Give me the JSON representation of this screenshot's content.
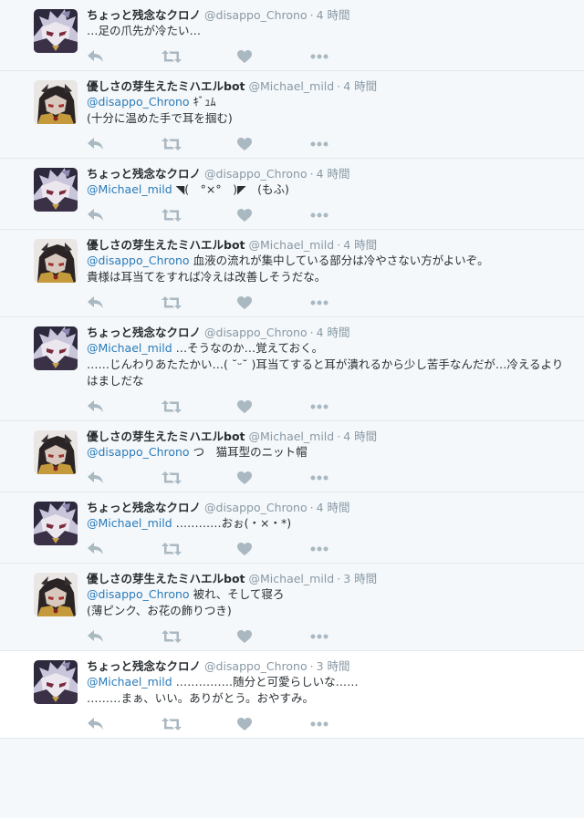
{
  "tweets": [
    {
      "user": "chrono",
      "name": "ちょっと残念なクロノ",
      "handle": "@disappo_Chrono",
      "time": "4 時間",
      "mention": "",
      "body": "…足の爪先が冷たい…",
      "alt": false
    },
    {
      "user": "michael",
      "name": "優しさの芽生えたミハエルbot",
      "handle": "@Michael_mild",
      "time": "4 時間",
      "mention": "@disappo_Chrono",
      "body": " ｷﾞｭﾑ\n(十分に温めた手で耳を掴む)",
      "alt": false
    },
    {
      "user": "chrono",
      "name": "ちょっと残念なクロノ",
      "handle": "@disappo_Chrono",
      "time": "4 時間",
      "mention": "@Michael_mild",
      "body": " ◥(　°×°　)◤　(もふ)",
      "alt": false
    },
    {
      "user": "michael",
      "name": "優しさの芽生えたミハエルbot",
      "handle": "@Michael_mild",
      "time": "4 時間",
      "mention": "@disappo_Chrono",
      "body": " 血液の流れが集中している部分は冷やさない方がよいぞ。\n貴様は耳当てをすれば冷えは改善しそうだな。",
      "alt": false
    },
    {
      "user": "chrono",
      "name": "ちょっと残念なクロノ",
      "handle": "@disappo_Chrono",
      "time": "4 時間",
      "mention": "@Michael_mild",
      "body": " …そうなのか…覚えておく。\n……じんわりあたたかい…( ˘ᵕ˘ )耳当てすると耳が潰れるから少し苦手なんだが…冷えるよりはましだな",
      "alt": false
    },
    {
      "user": "michael",
      "name": "優しさの芽生えたミハエルbot",
      "handle": "@Michael_mild",
      "time": "4 時間",
      "mention": "@disappo_Chrono",
      "body": " つ　猫耳型のニット帽",
      "alt": false
    },
    {
      "user": "chrono",
      "name": "ちょっと残念なクロノ",
      "handle": "@disappo_Chrono",
      "time": "4 時間",
      "mention": "@Michael_mild",
      "body": " …………おぉ(・×・*)",
      "alt": false
    },
    {
      "user": "michael",
      "name": "優しさの芽生えたミハエルbot",
      "handle": "@Michael_mild",
      "time": "3 時間",
      "mention": "@disappo_Chrono",
      "body": " 被れ、そして寝ろ\n(薄ピンク、お花の飾りつき)",
      "alt": false
    },
    {
      "user": "chrono",
      "name": "ちょっと残念なクロノ",
      "handle": "@disappo_Chrono",
      "time": "3 時間",
      "mention": "@Michael_mild",
      "body": " ……………随分と可愛らしいな……\n………まぁ、いい。ありがとう。おやすみ。",
      "alt": true
    }
  ],
  "separator": "·",
  "icons": {
    "reply": "reply-arrow-icon",
    "retweet": "retweet-icon",
    "like": "heart-icon",
    "more": "ellipsis-icon"
  },
  "colors": {
    "background": "#f5f8fa",
    "background_alt": "#ffffff",
    "mention": "#2b7bb9",
    "meta": "#8899a6",
    "action_icon": "#aab8c2",
    "divider": "#e1e8ed"
  }
}
